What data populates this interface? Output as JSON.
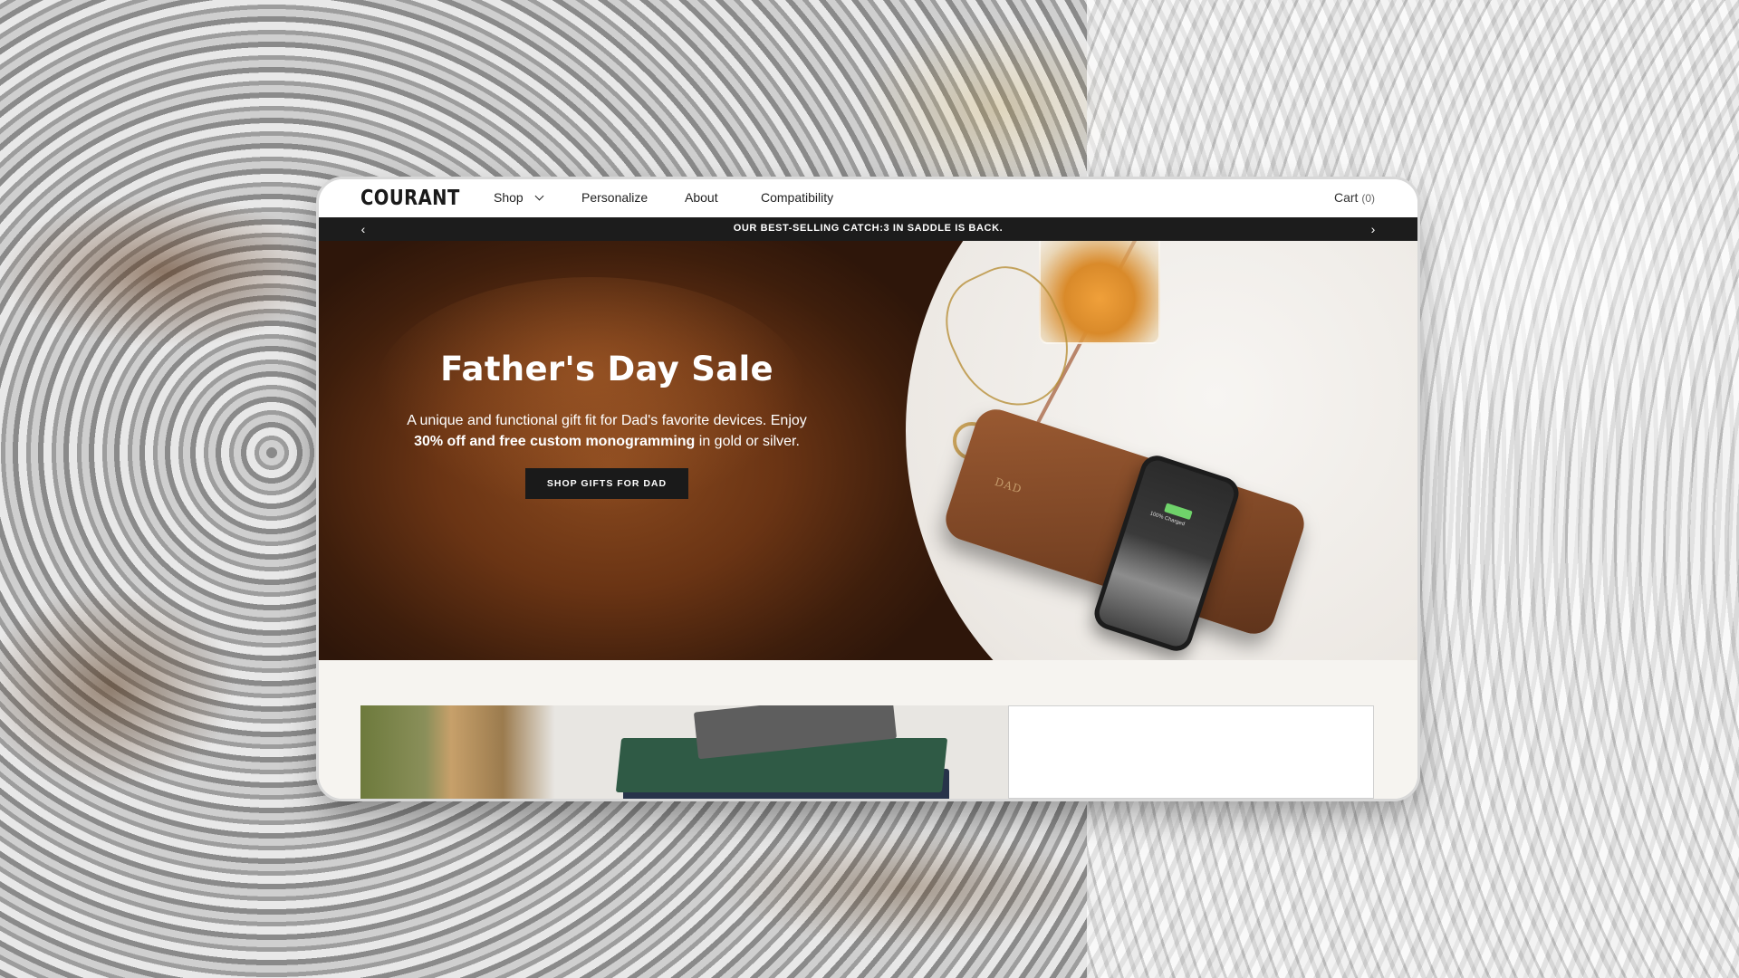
{
  "nav": {
    "logo": "COURANT",
    "items": [
      {
        "label": "Shop"
      },
      {
        "label": "Personalize"
      },
      {
        "label": "About"
      },
      {
        "label": "Compatibility"
      }
    ],
    "cart_label": "Cart",
    "cart_count": "(0)"
  },
  "announcement": {
    "text": "OUR BEST-SELLING CATCH:3 IN SADDLE IS BACK.",
    "prev_icon": "chevron-left-icon",
    "next_icon": "chevron-right-icon"
  },
  "hero": {
    "title": "Father's Day Sale",
    "body_part1": "A unique and functional gift fit for Dad's favorite devices. Enjoy ",
    "body_bold": "30% off and free custom monogramming",
    "body_part2": " in gold or silver.",
    "cta_label": "SHOP GIFTS FOR DAD",
    "pad_monogram": "DAD",
    "phone_status": "100% Charged"
  },
  "colors": {
    "announcement_bg": "#1c1c1c",
    "cta_bg": "#1a1a1a",
    "hero_brown": "#6a3414",
    "section_bg": "#f6f4f0"
  }
}
